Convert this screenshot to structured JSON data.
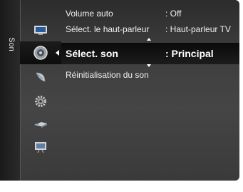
{
  "menu": {
    "category_label": "Son",
    "icons": [
      "picture-icon",
      "sound-icon",
      "channel-icon",
      "setup-icon",
      "input-icon",
      "application-icon"
    ],
    "rows": [
      {
        "label": "Volume auto",
        "value": ": Off"
      },
      {
        "label": "Sélect. le haut-parleur",
        "value": ": Haut-parleur TV"
      },
      {
        "label": "Sélect. son",
        "value": ": Principal"
      },
      {
        "label": "Réinitialisation du son",
        "value": ""
      }
    ]
  },
  "colors": {
    "panel": "#3e3e3e",
    "selected_row": "#0a0a0a",
    "text": "#f0f0f0"
  }
}
